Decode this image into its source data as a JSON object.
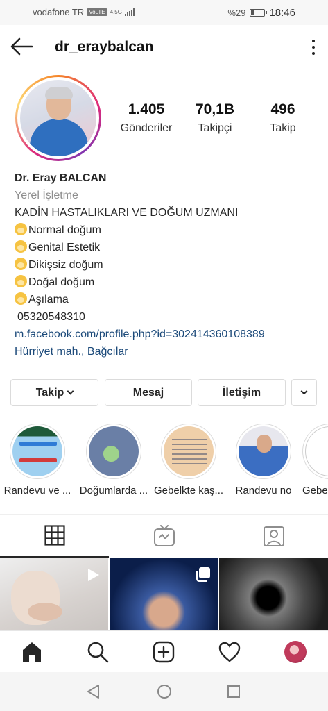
{
  "status_bar": {
    "carrier": "vodafone TR",
    "volte": "VoLTE",
    "network": "4.5G",
    "battery": "%29",
    "time": "18:46"
  },
  "header": {
    "username": "dr_eraybalcan",
    "back_icon": "arrow-left-icon",
    "more_icon": "kebab-menu-icon"
  },
  "stats": [
    {
      "value": "1.405",
      "label": "Gönderiler"
    },
    {
      "value": "70,1B",
      "label": "Takipçi"
    },
    {
      "value": "496",
      "label": "Takip"
    }
  ],
  "bio": {
    "name": "Dr. Eray BALCAN",
    "category": "Yerel İşletme",
    "headline": "KADİN HASTALIKLARI VE  DOĞUM UZMANI",
    "items": [
      "Normal doğum",
      "Genital Estetik",
      "Dikişsiz doğum",
      "Doğal doğum",
      "Aşılama"
    ],
    "phone": "05320548310",
    "link": "m.facebook.com/profile.php?id=302414360108389",
    "address": "Hürriyet mah., Bağcılar"
  },
  "actions": {
    "follow": "Takip",
    "message": "Mesaj",
    "contact": "İletişim"
  },
  "highlights": [
    {
      "label": "Randevu ve ..."
    },
    {
      "label": "Doğumlarda ..."
    },
    {
      "label": "Gebelkte kaş..."
    },
    {
      "label": "Randevu no"
    },
    {
      "label": "Gebe"
    }
  ],
  "tabs": [
    {
      "icon": "grid-icon",
      "active": true
    },
    {
      "icon": "igtv-icon",
      "active": false
    },
    {
      "icon": "tagged-icon",
      "active": false
    }
  ],
  "colors": {
    "link": "#1c4a7a",
    "category": "#8e8e8e",
    "border": "#dbdbdb"
  }
}
